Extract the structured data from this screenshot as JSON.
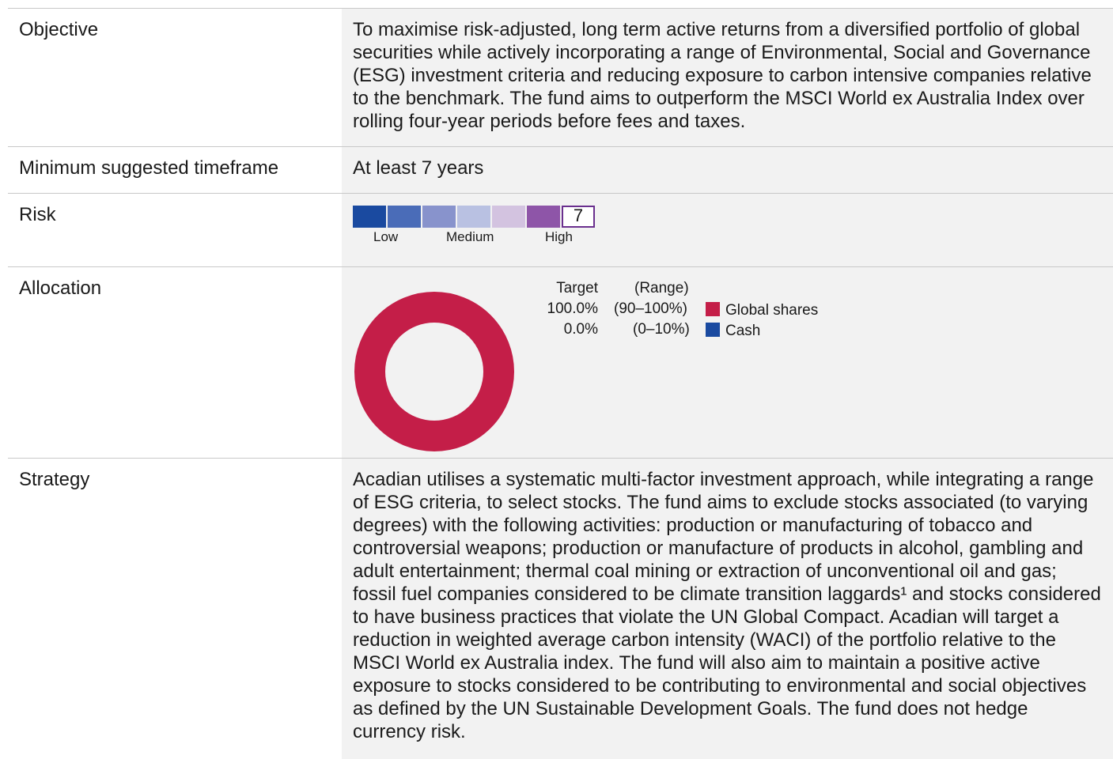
{
  "rows": {
    "objective": {
      "label": "Objective",
      "text": "To maximise risk-adjusted, long term active returns from a diversified portfolio of global securities while actively incorporating a range of Environmental, Social and Governance (ESG) investment criteria and reducing exposure to carbon intensive companies relative to the benchmark. The fund aims to outperform the MSCI World ex Australia Index over rolling four-year periods before fees and taxes."
    },
    "timeframe": {
      "label": "Minimum suggested timeframe",
      "text": "At least 7 years"
    },
    "risk": {
      "label": "Risk",
      "level": 7,
      "scale_max": 7,
      "current_label": "7",
      "segment_colors": [
        "#1a4aa0",
        "#4a6cb8",
        "#8893cc",
        "#b9c1e2",
        "#d3c3e0",
        "#8e55a8"
      ],
      "outline_color": "#6a2f8e",
      "scale_labels": {
        "low": "Low",
        "medium": "Medium",
        "high": "High"
      }
    },
    "allocation": {
      "label": "Allocation",
      "header_target": "Target",
      "header_range": "(Range)"
    },
    "strategy": {
      "label": "Strategy",
      "text": "Acadian utilises a systematic multi-factor investment approach, while integrating a range of ESG criteria, to select stocks. The fund aims to exclude stocks associated (to varying degrees) with the following activities: production or manufacturing of tobacco and controversial weapons; production or manufacture of products in alcohol, gambling and adult entertainment; thermal coal mining or extraction of unconventional oil and gas; fossil fuel companies considered to be climate transition laggards¹ and stocks considered to have business practices that violate the UN Global Compact. Acadian will target a reduction in weighted average carbon intensity (WACI) of the portfolio relative to the MSCI World ex Australia index. The fund will also aim to maintain a positive active exposure to stocks considered to be contributing to environmental and social objectives as defined by the UN Sustainable Development Goals. The fund does not hedge currency risk."
    }
  },
  "chart_data": {
    "type": "pie",
    "categories": [
      "Global shares",
      "Cash"
    ],
    "values": [
      100.0,
      0.0
    ],
    "value_labels": [
      "100.0%",
      "0.0%"
    ],
    "range_labels": [
      "(90–100%)",
      "(0–10%)"
    ],
    "colors": [
      "#c41e48",
      "#1a4aa0"
    ]
  }
}
